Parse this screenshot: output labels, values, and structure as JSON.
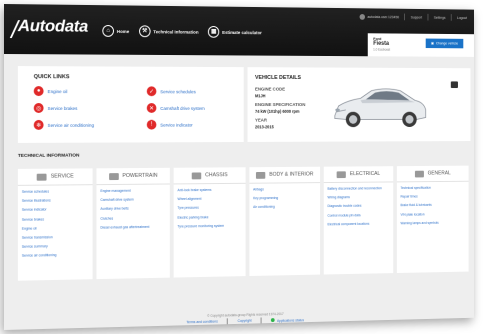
{
  "header": {
    "logo": "Autodata",
    "nav": [
      {
        "label": "Home",
        "icon": "home-icon"
      },
      {
        "label": "Technical information",
        "icon": "wrench-icon"
      },
      {
        "label": "Estimate calculator",
        "icon": "calculator-icon"
      }
    ],
    "topbar": {
      "user": "autodata.user.123456",
      "support": "Support",
      "settings": "Settings",
      "logout": "Logout"
    },
    "vehicle": {
      "make": "Ford",
      "model": "Fiesta",
      "variant": "1.0 Ecoboost",
      "change_label": "Change vehicle"
    }
  },
  "quick_links": {
    "title": "QUICK LINKS",
    "items": [
      {
        "label": "Engine oil",
        "icon": "oil-icon"
      },
      {
        "label": "Service schedules",
        "icon": "check-icon"
      },
      {
        "label": "Service brakes",
        "icon": "brake-icon"
      },
      {
        "label": "Camshaft drive system",
        "icon": "camshaft-icon"
      },
      {
        "label": "Service air conditioning",
        "icon": "snowflake-icon"
      },
      {
        "label": "Service indicator",
        "icon": "warning-icon"
      }
    ]
  },
  "vehicle_details": {
    "title": "VEHICLE DETAILS",
    "engine_code_label": "ENGINE CODE",
    "engine_code": "M1JH",
    "engine_spec_label": "ENGINE SPECIFICATION",
    "engine_spec": "74 kW (101hp) 6000 rpm",
    "year_label": "YEAR",
    "year": "2013-2015"
  },
  "technical_information": {
    "title": "TECHNICAL INFORMATION",
    "categories": [
      {
        "name": "SERVICE",
        "links": [
          "Service schedules",
          "Service illustrations",
          "Service indicator",
          "Service brakes",
          "Engine oil",
          "Service transmission",
          "Service summary",
          "Service air conditioning"
        ]
      },
      {
        "name": "POWERTRAIN",
        "links": [
          "Engine management",
          "Camshaft drive system",
          "Auxiliary drive belts",
          "Clutches",
          "Diesel exhaust gas aftertreatment"
        ]
      },
      {
        "name": "CHASSIS",
        "links": [
          "Anti-lock brake systems",
          "Wheel alignment",
          "Tyre pressures",
          "Electric parking brake",
          "Tyre pressure monitoring system"
        ]
      },
      {
        "name": "BODY & INTERIOR",
        "links": [
          "Airbags",
          "Key programming",
          "Air conditioning"
        ]
      },
      {
        "name": "ELECTRICAL",
        "links": [
          "Battery disconnection and reconnection",
          "Wiring diagrams",
          "Diagnostic trouble codes",
          "Control module pin data",
          "Electrical component locations"
        ]
      },
      {
        "name": "GENERAL",
        "links": [
          "Technical specification",
          "Repair times",
          "Brake fluid & lubricants",
          "VIN plate location",
          "Warning lamps and symbols"
        ]
      }
    ]
  },
  "footer": {
    "copyright": "© Copyright autodata-group Rights reserved 1974-2017",
    "links": [
      "Terms and conditions",
      "Copyright",
      "Applications status"
    ]
  },
  "colors": {
    "accent": "#1a73c8",
    "icon_red": "#e02a2a",
    "header_bg": "#1a1a1a",
    "link": "#2a6ec8",
    "status_ok": "#2db34a"
  }
}
